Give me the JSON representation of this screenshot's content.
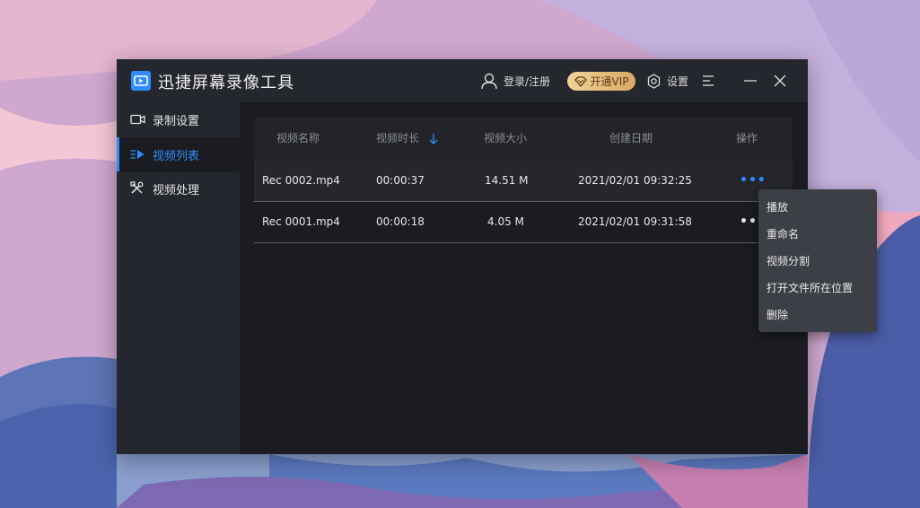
{
  "app": {
    "title": "迅捷屏幕录像工具",
    "accent_color": "#2f8cff"
  },
  "titlebar": {
    "login_label": "登录/注册",
    "vip_label": "开通VIP",
    "settings_label": "设置",
    "icons": [
      "user-icon",
      "vip-diamond-icon",
      "settings-gear-icon",
      "menu-icon",
      "minimize-icon",
      "close-icon"
    ]
  },
  "sidebar": {
    "items": [
      {
        "label": "录制设置",
        "icon": "camera-icon",
        "active": false
      },
      {
        "label": "视频列表",
        "icon": "video-list-icon",
        "active": true
      },
      {
        "label": "视频处理",
        "icon": "video-tools-icon",
        "active": false
      }
    ]
  },
  "table": {
    "columns": [
      "视频名称",
      "视频时长",
      "视频大小",
      "创建日期",
      "操作"
    ],
    "sort_column": "视频时长",
    "sort_direction": "down",
    "rows": [
      {
        "name": "Rec 0002.mp4",
        "duration": "00:00:37",
        "size": "14.51 M",
        "date": "2021/02/01 09:32:25",
        "action": "•••"
      },
      {
        "name": "Rec 0001.mp4",
        "duration": "00:00:18",
        "size": "4.05 M",
        "date": "2021/02/01 09:31:58",
        "action": "•••"
      }
    ]
  },
  "context_menu": {
    "items": [
      "播放",
      "重命名",
      "视频分割",
      "打开文件所在位置",
      "删除"
    ]
  }
}
